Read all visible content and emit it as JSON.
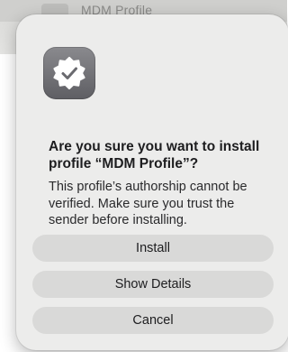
{
  "background_window": {
    "title": "MDM Profile"
  },
  "dialog": {
    "icon": "verified-badge-checkmark-icon",
    "title": "Are you sure you want to install\nprofile “MDM Profile”?",
    "message": "This profile’s authorship cannot be\nverified. Make sure you trust the\nsender before installing.",
    "buttons": {
      "install": "Install",
      "show_details": "Show Details",
      "cancel": "Cancel"
    }
  },
  "colors": {
    "dialog_background": "#ececeb",
    "button_background": "#d9d9d8",
    "icon_background": "#6e6e73"
  }
}
